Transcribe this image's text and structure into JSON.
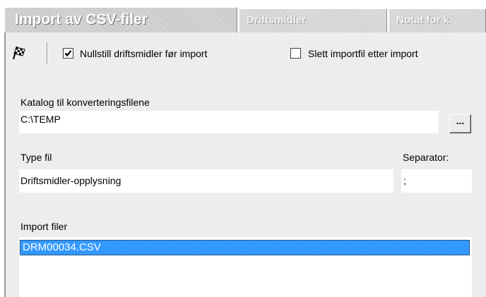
{
  "tabs": [
    {
      "label": "Import av CSV-filer",
      "active": true
    },
    {
      "label": "Driftsmidler",
      "active": false
    },
    {
      "label": "Notat for k",
      "active": false
    }
  ],
  "toolbar": {
    "run_icon": "checkered-flag-icon",
    "reset_checkbox": {
      "label": "Nullstill driftsmidler før import",
      "checked": true
    },
    "delete_checkbox": {
      "label": "Slett importfil etter import",
      "checked": false
    }
  },
  "form": {
    "catalog_label": "Katalog til konverteringsfilene",
    "catalog_value": "C:\\TEMP",
    "browse_label": "...",
    "file_type_label": "Type fil",
    "file_type_value": "Driftsmidler-opplysning",
    "separator_label": "Separator:",
    "separator_value": ";",
    "import_files_label": "Import filer",
    "import_files": [
      {
        "name": "DRM00034.CSV",
        "selected": true
      }
    ]
  },
  "colors": {
    "selection": "#3399ff",
    "panel_background": "#ededed",
    "tab_background": "#c9c9c9"
  }
}
